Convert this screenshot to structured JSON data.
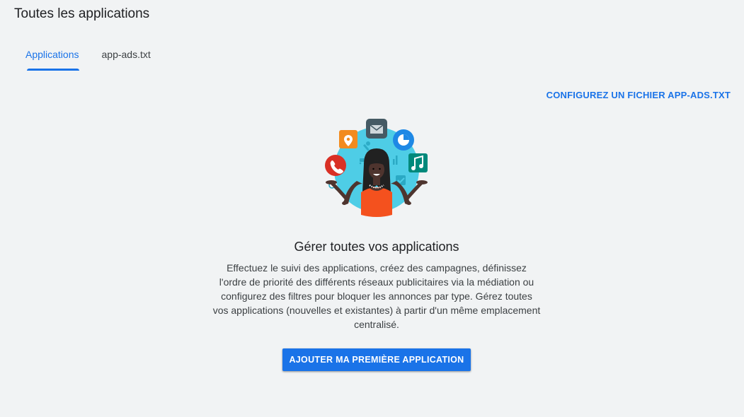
{
  "header": {
    "title": "Toutes les applications"
  },
  "tabs": [
    {
      "label": "Applications",
      "active": true
    },
    {
      "label": "app-ads.txt",
      "active": false
    }
  ],
  "config_link": "CONFIGUREZ UN FICHIER APP-ADS.TXT",
  "empty_state": {
    "title": "Gérer toutes vos applications",
    "description": "Effectuez le suivi des applications, créez des campagnes, définissez l'ordre de priorité des différents réseaux publicitaires via la médiation ou configurez des filtres pour bloquer les annonces par type. Gérez toutes vos applications (nouvelles et existantes) à partir d'un même emplacement centralisé.",
    "button_label": "AJOUTER MA PREMIÈRE APPLICATION"
  },
  "colors": {
    "accent": "#1a73e8",
    "background": "#f1f3f4",
    "text": "#202124"
  },
  "icons": [
    "location-pin-icon",
    "mail-icon",
    "pie-chart-icon",
    "phone-icon",
    "music-note-icon",
    "wrench-icon",
    "cart-icon",
    "bar-chart-icon",
    "search-icon",
    "checkbox-icon"
  ]
}
